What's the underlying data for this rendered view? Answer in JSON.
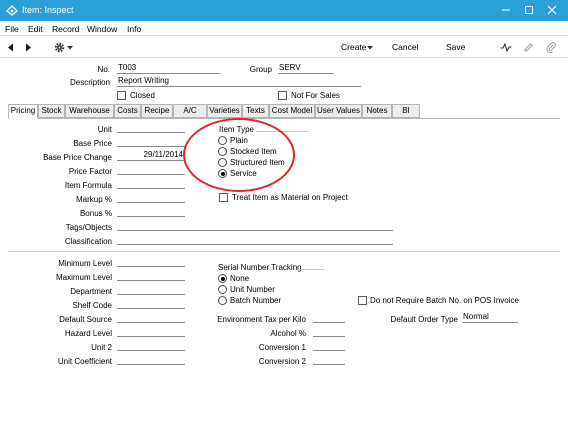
{
  "window": {
    "title": "Item: Inspect",
    "colors": {
      "titlebar": "#2b9fd8",
      "highlight": "#e0242a"
    }
  },
  "menu": {
    "items": [
      "File",
      "Edit",
      "Record",
      "Window",
      "Info"
    ]
  },
  "toolbar": {
    "create_label": "Create",
    "cancel_label": "Cancel",
    "save_label": "Save",
    "icons": [
      "arrow-left-icon",
      "arrow-right-icon",
      "gear-icon",
      "activity-icon",
      "paperclip-icon"
    ]
  },
  "header": {
    "no_label": "No.",
    "no_value": "T003",
    "group_label": "Group",
    "group_value": "SERV",
    "description_label": "Description",
    "description_value": "Report Writing",
    "closed_label": "Closed",
    "not_for_sales_label": "Not For Sales"
  },
  "tabs": [
    "Pricing",
    "Stock",
    "Warehouse",
    "Costs",
    "Recipe",
    "A/C",
    "Varieties",
    "Texts",
    "Cost Model",
    "User Values",
    "Notes",
    "BI"
  ],
  "active_tab": "Pricing",
  "pricing": {
    "unit_label": "Unit",
    "unit_value": "",
    "base_price_label": "Base Price",
    "base_price_value": "",
    "base_price_change_label": "Base Price Change",
    "base_price_change_value": "29/11/2014",
    "price_factor_label": "Price Factor",
    "item_formula_label": "Item Formula",
    "markup_label": "Markup %",
    "bonus_label": "Bonus %",
    "tags_label": "Tags/Objects",
    "classification_label": "Classification",
    "item_type_label": "Item Type",
    "item_type_options": [
      "Plain",
      "Stocked Item",
      "Structured Item",
      "Service"
    ],
    "item_type_selected": "Service",
    "treat_as_material_label": "Treat Item as Material on Project"
  },
  "stock": {
    "minimum_level_label": "Minimum Level",
    "maximum_level_label": "Maximum Level",
    "department_label": "Department",
    "shelf_code_label": "Shelf Code",
    "default_source_label": "Default Source",
    "hazard_level_label": "Hazard Level",
    "unit2_label": "Unit 2",
    "unit_coefficient_label": "Unit Coefficient",
    "serial_tracking_label": "Serial Number Tracking",
    "serial_options": [
      "None",
      "Unit Number",
      "Batch Number"
    ],
    "serial_selected": "None",
    "no_batch_pos_label": "Do not Require Batch No. on POS Invoice",
    "env_tax_label": "Environment Tax per Kilo",
    "alcohol_label": "Alcohol %",
    "conversion1_label": "Conversion 1",
    "conversion2_label": "Conversion 2",
    "default_order_type_label": "Default Order Type",
    "default_order_type_value": "Normal"
  }
}
